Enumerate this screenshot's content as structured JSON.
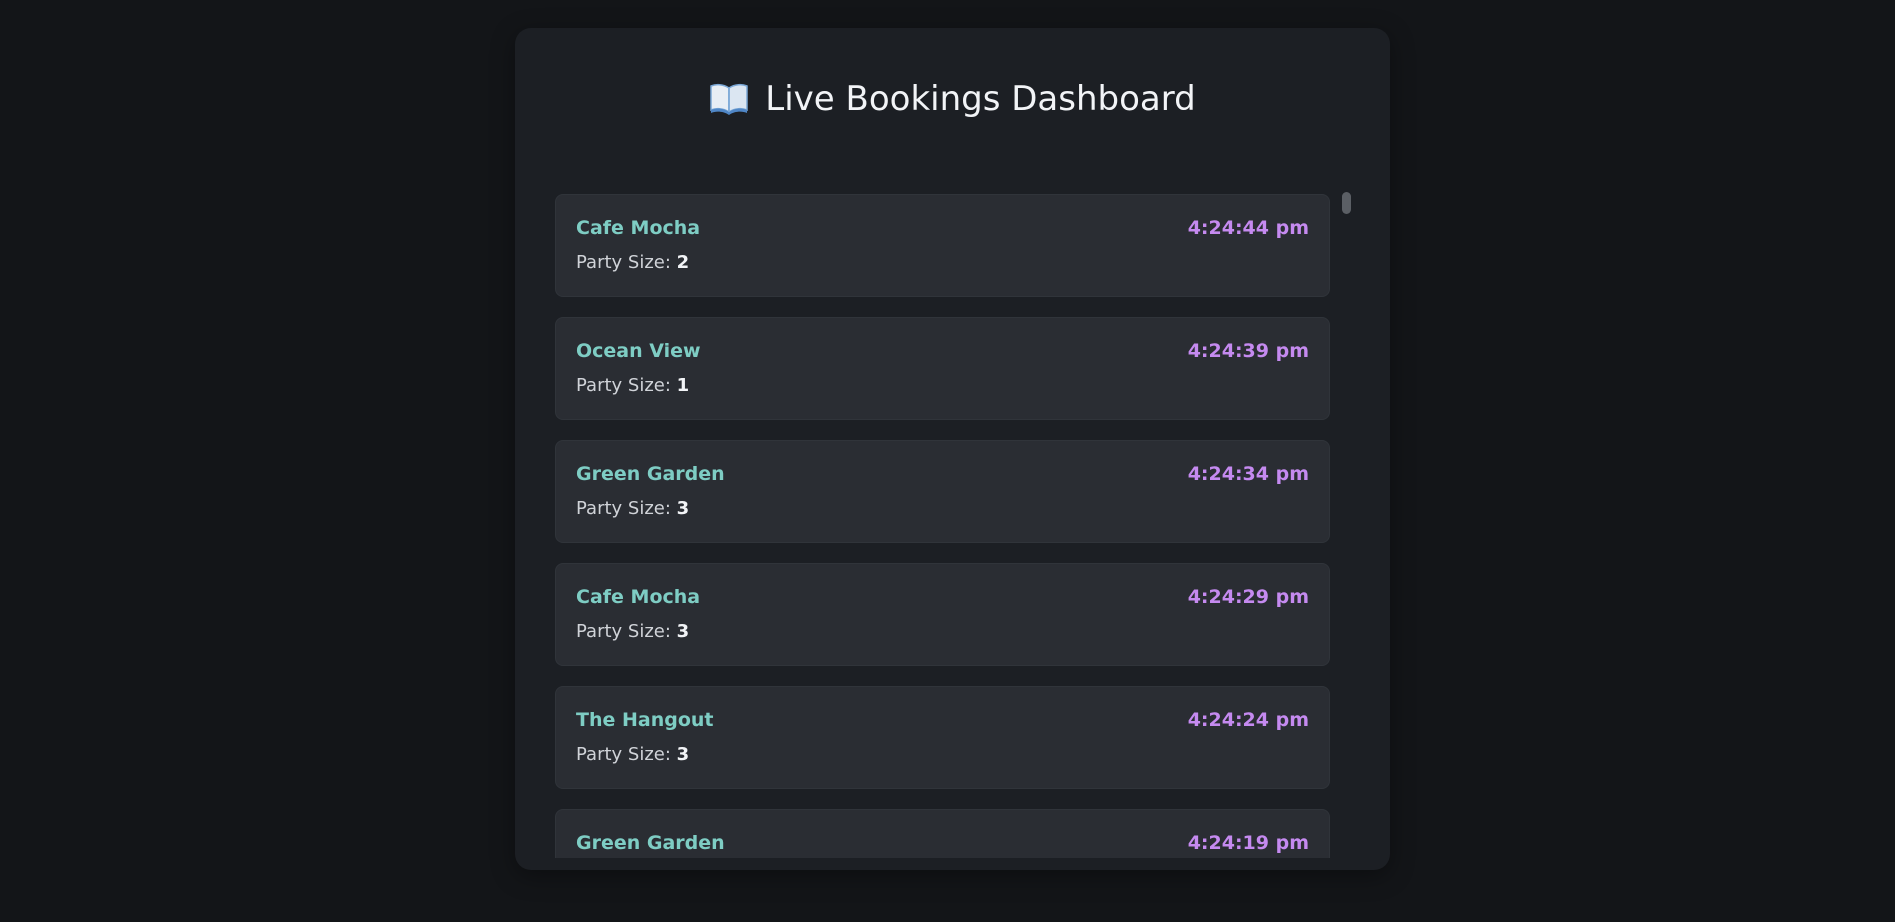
{
  "header": {
    "icon": "open-book-icon",
    "title": "Live Bookings Dashboard"
  },
  "party_label": "Party Size:",
  "colors": {
    "page_bg": "#131518",
    "panel_bg": "#1c1f24",
    "card_bg": "#2a2d33",
    "venue": "#7ecdc4",
    "time": "#c58af0",
    "title": "#f2f4f7"
  },
  "bookings": [
    {
      "venue": "Cafe Mocha",
      "time": "4:24:44 pm",
      "party_size": "2"
    },
    {
      "venue": "Ocean View",
      "time": "4:24:39 pm",
      "party_size": "1"
    },
    {
      "venue": "Green Garden",
      "time": "4:24:34 pm",
      "party_size": "3"
    },
    {
      "venue": "Cafe Mocha",
      "time": "4:24:29 pm",
      "party_size": "3"
    },
    {
      "venue": "The Hangout",
      "time": "4:24:24 pm",
      "party_size": "3"
    },
    {
      "venue": "Green Garden",
      "time": "4:24:19 pm",
      "party_size": ""
    }
  ]
}
